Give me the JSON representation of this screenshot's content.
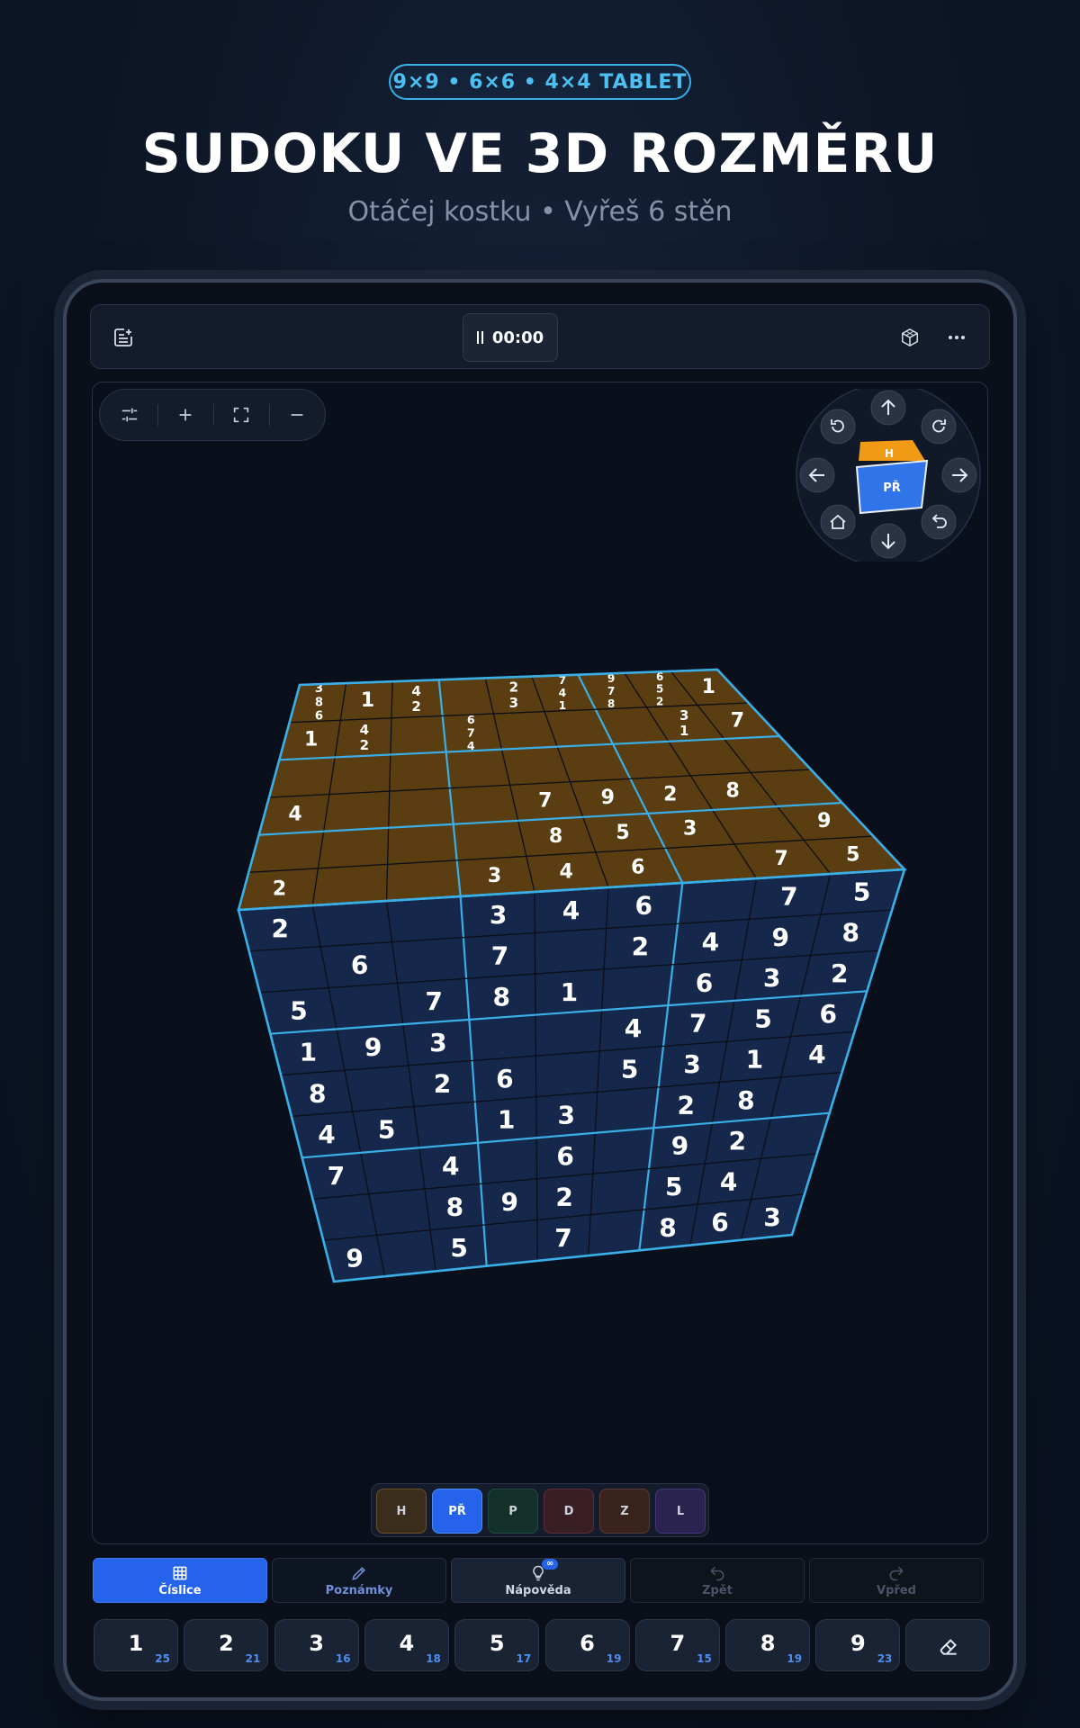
{
  "hero": {
    "badge": "9×9 • 6×6 • 4×4 TABLET",
    "title": "SUDOKU VE 3D ROZMĚRU",
    "subtitle": "Otáčej kostku • Vyřeš 6 stěn"
  },
  "topbar": {
    "timer": "00:00",
    "icons": [
      "new-game-icon",
      "pause-icon",
      "cube-view-icon",
      "more-icon"
    ]
  },
  "zoom_controls": {
    "icons": [
      "sliders-icon",
      "zoom-in-icon",
      "fit-screen-icon",
      "zoom-out-icon"
    ]
  },
  "cube_nav": {
    "top_face": "H",
    "front_face": "PŘ",
    "top_color": "#f19a16",
    "front_color": "#2f74e8",
    "icons": [
      "rotate-ccw-icon",
      "arrow-up-icon",
      "rotate-cw-icon",
      "arrow-left-icon",
      "arrow-right-icon",
      "home-icon",
      "arrow-down-icon",
      "undo-view-icon"
    ]
  },
  "cube": {
    "top_color": "#5a3d10",
    "front_color": "#15274a",
    "line_color": "#3aaee6",
    "top_face": [
      [
        "3\n8\n6",
        "1",
        "4\n2",
        "",
        "2\n3",
        "7\n4\n1",
        "9\n7\n8",
        "6\n5\n2",
        "1"
      ],
      [
        "1",
        "4\n2",
        "",
        "6\n7\n4",
        "",
        "",
        "",
        "3\n1",
        "7"
      ],
      [
        "",
        "",
        "",
        "",
        "",
        "",
        "",
        "",
        ""
      ],
      [
        "4",
        "",
        "",
        "",
        "7",
        "9",
        "2",
        "8",
        ""
      ],
      [
        "",
        "",
        "",
        "",
        "8",
        "5",
        "3",
        "",
        "9"
      ],
      [
        "2",
        "",
        "",
        "3",
        "4",
        "6",
        "",
        "7",
        "5"
      ]
    ],
    "front_face": [
      [
        "2",
        "",
        "",
        "3",
        "4",
        "6",
        "",
        "7",
        "5"
      ],
      [
        "",
        "6",
        "",
        "7",
        "",
        "2",
        "4",
        "9",
        "8"
      ],
      [
        "5",
        "",
        "7",
        "8",
        "1",
        "",
        "6",
        "3",
        "2"
      ],
      [
        "1",
        "9",
        "3",
        "",
        "",
        "4",
        "7",
        "5",
        "6"
      ],
      [
        "8",
        "",
        "2",
        "6",
        "",
        "5",
        "3",
        "1",
        "4"
      ],
      [
        "4",
        "5",
        "",
        "1",
        "3",
        "",
        "2",
        "8",
        ""
      ],
      [
        "7",
        "",
        "4",
        "",
        "6",
        "",
        "9",
        "2",
        ""
      ],
      [
        "",
        "",
        "8",
        "9",
        "2",
        "",
        "5",
        "4",
        ""
      ],
      [
        "9",
        "",
        "5",
        "",
        "7",
        "",
        "8",
        "6",
        "3"
      ]
    ]
  },
  "face_tabs": [
    {
      "label": "H",
      "bg": "#3a2d1c",
      "border": "#6b5028",
      "active": false
    },
    {
      "label": "PŘ",
      "bg": "#2563eb",
      "border": "#4d8ef5",
      "active": true
    },
    {
      "label": "P",
      "bg": "#133029",
      "border": "#1f4a40",
      "active": false
    },
    {
      "label": "D",
      "bg": "#3a1e26",
      "border": "#5a2e38",
      "active": false
    },
    {
      "label": "Z",
      "bg": "#3a231d",
      "border": "#5a3a2e",
      "active": false
    },
    {
      "label": "L",
      "bg": "#2a2350",
      "border": "#40387a",
      "active": false
    }
  ],
  "tools": [
    {
      "label": "Číslice",
      "icon": "grid-icon",
      "state": "active"
    },
    {
      "label": "Poznámky",
      "icon": "pencil-icon",
      "state": "normal"
    },
    {
      "label": "Nápověda",
      "icon": "lightbulb-icon",
      "state": "normal",
      "badge": "∞"
    },
    {
      "label": "Zpět",
      "icon": "undo-icon",
      "state": "disabled"
    },
    {
      "label": "Vpřed",
      "icon": "redo-icon",
      "state": "disabled"
    }
  ],
  "numpad": [
    {
      "n": "1",
      "count": "25"
    },
    {
      "n": "2",
      "count": "21"
    },
    {
      "n": "3",
      "count": "16"
    },
    {
      "n": "4",
      "count": "18"
    },
    {
      "n": "5",
      "count": "17"
    },
    {
      "n": "6",
      "count": "19"
    },
    {
      "n": "7",
      "count": "15"
    },
    {
      "n": "8",
      "count": "19"
    },
    {
      "n": "9",
      "count": "23"
    }
  ],
  "erase_icon": "eraser-icon"
}
